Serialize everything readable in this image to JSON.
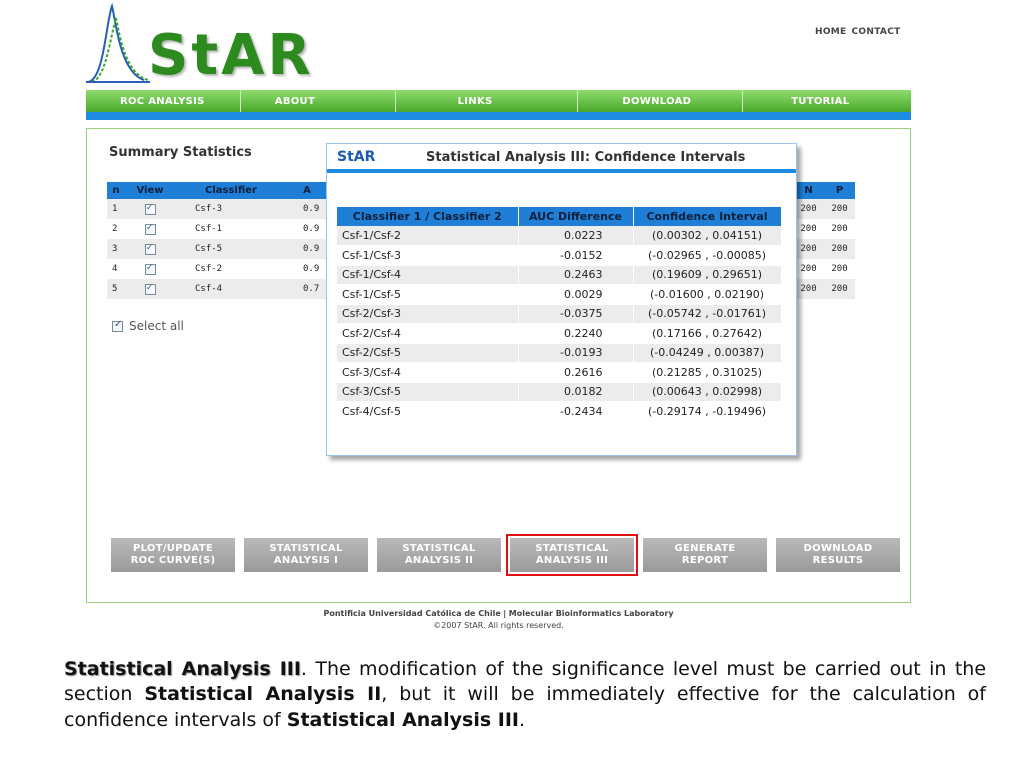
{
  "logo": {
    "text": "StAR"
  },
  "top_links": [
    "HOME",
    "CONTACT"
  ],
  "nav": [
    "ROC ANALYSIS",
    "ABOUT",
    "LINKS",
    "DOWNLOAD",
    "TUTORIAL"
  ],
  "colors": {
    "green_accent": "#48a82c",
    "blue_accent": "#1d8be0",
    "logo_green": "#2d8a1e",
    "highlight_red": "#e01010"
  },
  "summary": {
    "title": "Summary Statistics",
    "headers": [
      "n",
      "View",
      "Classifier",
      "A"
    ],
    "right_headers": [
      "N",
      "P"
    ],
    "rows": [
      {
        "n": "1",
        "classifier": "Csf-3",
        "a": "0.9",
        "N": "200",
        "P": "200"
      },
      {
        "n": "2",
        "classifier": "Csf-1",
        "a": "0.9",
        "N": "200",
        "P": "200"
      },
      {
        "n": "3",
        "classifier": "Csf-5",
        "a": "0.9",
        "N": "200",
        "P": "200"
      },
      {
        "n": "4",
        "classifier": "Csf-2",
        "a": "0.9",
        "N": "200",
        "P": "200"
      },
      {
        "n": "5",
        "classifier": "Csf-4",
        "a": "0.7",
        "N": "200",
        "P": "200"
      }
    ],
    "select_all": "Select all"
  },
  "popup": {
    "brand": "StAR",
    "title": "Statistical Analysis III: Confidence Intervals",
    "headers": [
      "Classifier 1 / Classifier 2",
      "AUC Difference",
      "Confidence Interval"
    ],
    "rows": [
      {
        "pair": "Csf-1/Csf-2",
        "diff": "0.0223",
        "ci": "(0.00302 , 0.04151)"
      },
      {
        "pair": "Csf-1/Csf-3",
        "diff": "-0.0152",
        "ci": "(-0.02965 , -0.00085)"
      },
      {
        "pair": "Csf-1/Csf-4",
        "diff": "0.2463",
        "ci": "(0.19609 , 0.29651)"
      },
      {
        "pair": "Csf-1/Csf-5",
        "diff": "0.0029",
        "ci": "(-0.01600 , 0.02190)"
      },
      {
        "pair": "Csf-2/Csf-3",
        "diff": "-0.0375",
        "ci": "(-0.05742 , -0.01761)"
      },
      {
        "pair": "Csf-2/Csf-4",
        "diff": "0.2240",
        "ci": "(0.17166 , 0.27642)"
      },
      {
        "pair": "Csf-2/Csf-5",
        "diff": "-0.0193",
        "ci": "(-0.04249 , 0.00387)"
      },
      {
        "pair": "Csf-3/Csf-4",
        "diff": "0.2616",
        "ci": "(0.21285 , 0.31025)"
      },
      {
        "pair": "Csf-3/Csf-5",
        "diff": "0.0182",
        "ci": "(0.00643 , 0.02998)"
      },
      {
        "pair": "Csf-4/Csf-5",
        "diff": "-0.2434",
        "ci": "(-0.29174 , -0.19496)"
      }
    ]
  },
  "actions": [
    {
      "label": "PLOT/UPDATE\nROC CURVE(S)",
      "active": false
    },
    {
      "label": "STATISTICAL\nANALYSIS I",
      "active": false
    },
    {
      "label": "STATISTICAL\nANALYSIS II",
      "active": false
    },
    {
      "label": "STATISTICAL\nANALYSIS III",
      "active": true
    },
    {
      "label": "GENERATE\nREPORT",
      "active": false
    },
    {
      "label": "DOWNLOAD\nRESULTS",
      "active": false
    }
  ],
  "footer": {
    "org": "Pontificia Universidad Católica de Chile",
    "sep": "|",
    "lab": "Molecular Bioinformatics Laboratory",
    "copyright": "©2007 StAR. All rights reserved."
  },
  "caption": {
    "title": "Statistical Analysis III",
    "t1": ". The modification of the significance level must be carried out in the section ",
    "b1": "Statistical Analysis II",
    "t2": ", but it will be immediately effective for the calculation of confidence intervals of ",
    "b2": "Statistical Analysis III",
    "t3": "."
  }
}
